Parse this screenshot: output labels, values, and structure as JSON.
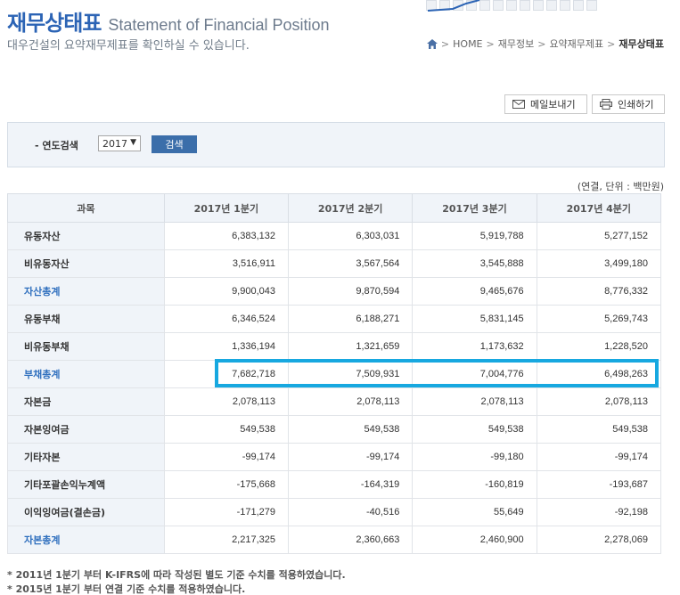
{
  "header": {
    "title_ko": "재무상태표",
    "title_en": "Statement of Financial Position",
    "subtitle": "대우건설의 요약재무제표를 확인하실 수 있습니다."
  },
  "breadcrumb": {
    "items": [
      "HOME",
      "재무정보",
      "요약재무제표"
    ],
    "current": "재무상태표"
  },
  "toolbar": {
    "mail_label": "메일보내기",
    "print_label": "인쇄하기"
  },
  "search": {
    "label": "- 연도검색",
    "year_value": "2017",
    "button_label": "검색"
  },
  "unit_note": "(연결, 단위 : 백만원)",
  "table": {
    "headers": [
      "과목",
      "2017년 1분기",
      "2017년 2분기",
      "2017년 3분기",
      "2017년 4분기"
    ],
    "rows": [
      {
        "label": "유동자산",
        "values": [
          "6,383,132",
          "6,303,031",
          "5,919,788",
          "5,277,152"
        ]
      },
      {
        "label": "비유동자산",
        "values": [
          "3,516,911",
          "3,567,564",
          "3,545,888",
          "3,499,180"
        ]
      },
      {
        "label": "자산총계",
        "values": [
          "9,900,043",
          "9,870,594",
          "9,465,676",
          "8,776,332"
        ]
      },
      {
        "label": "유동부채",
        "values": [
          "6,346,524",
          "6,188,271",
          "5,831,145",
          "5,269,743"
        ]
      },
      {
        "label": "비유동부채",
        "values": [
          "1,336,194",
          "1,321,659",
          "1,173,632",
          "1,228,520"
        ]
      },
      {
        "label": "부채총계",
        "values": [
          "7,682,718",
          "7,509,931",
          "7,004,776",
          "6,498,263"
        ]
      },
      {
        "label": "자본금",
        "values": [
          "2,078,113",
          "2,078,113",
          "2,078,113",
          "2,078,113"
        ]
      },
      {
        "label": "자본잉여금",
        "values": [
          "549,538",
          "549,538",
          "549,538",
          "549,538"
        ]
      },
      {
        "label": "기타자본",
        "values": [
          "-99,174",
          "-99,174",
          "-99,180",
          "-99,174"
        ]
      },
      {
        "label": "기타포괄손익누계액",
        "values": [
          "-175,668",
          "-164,319",
          "-160,819",
          "-193,687"
        ]
      },
      {
        "label": "이익잉여금(결손금)",
        "values": [
          "-171,279",
          "-40,516",
          "55,649",
          "-92,198"
        ]
      },
      {
        "label": "자본총계",
        "values": [
          "2,217,325",
          "2,360,663",
          "2,460,900",
          "2,278,069"
        ]
      }
    ]
  },
  "notes": [
    "* 2011년 1분기 부터 K-IFRS에 따라 작성된 별도 기준 수치를 적용하였습니다.",
    "* 2015년 1분기 부터 연결 기준 수치를 적용하였습니다."
  ],
  "colors": {
    "title_blue": "#2c64b5",
    "total_blue": "#2f6fbe",
    "highlight": "#17a8e0",
    "button_blue": "#3b6eaa"
  }
}
